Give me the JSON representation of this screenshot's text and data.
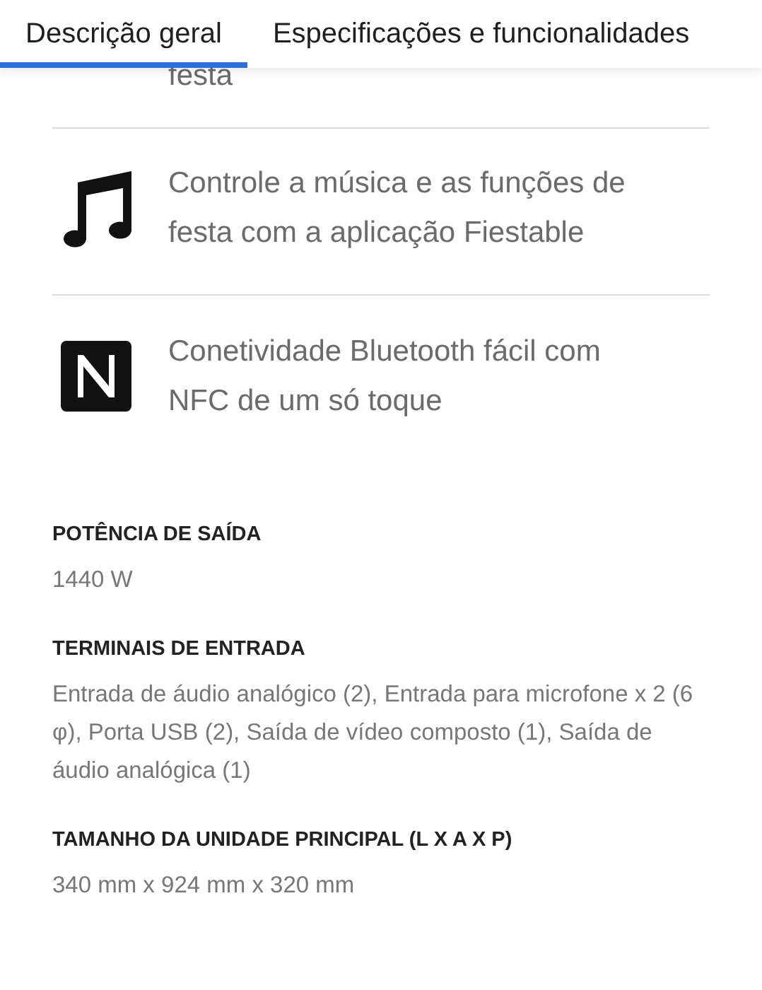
{
  "tabs": [
    {
      "label": "Descrição geral",
      "selected": true
    },
    {
      "label": "Especificações e funcionalidades",
      "selected": false
    }
  ],
  "previous_feature_tail": "festa",
  "features": [
    {
      "kind": "music",
      "text": "Controle a música e as funções de festa com a aplicação Fiestable"
    },
    {
      "kind": "nfc",
      "text": "Conetividade Bluetooth fácil com NFC de um só toque"
    }
  ],
  "specs": [
    {
      "label": "POTÊNCIA DE SAÍDA",
      "value": "1440 W"
    },
    {
      "label": "TERMINAIS DE ENTRADA",
      "value": "Entrada de áudio analógico (2), Entrada para microfone x 2 (6 φ), Porta USB (2), Saída de vídeo composto (1), Saída de áudio analógica (1)"
    },
    {
      "label": "TAMANHO DA UNIDADE PRINCIPAL (L X A X P)",
      "value": "340 mm x 924 mm x 320 mm"
    }
  ]
}
